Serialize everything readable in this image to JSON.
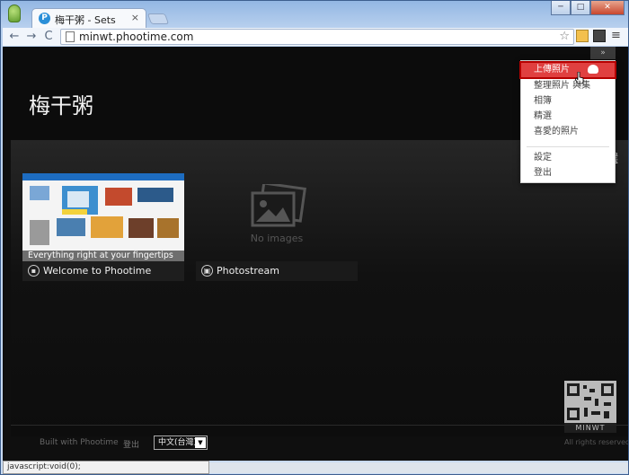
{
  "browser": {
    "tab_title": "梅干粥 - Sets",
    "tab_favicon": "P",
    "tab_close": "×",
    "url": "minwt.phootime.com",
    "status_text": "javascript:void(0);",
    "window_minimize": "─",
    "window_maximize": "□",
    "window_close": "✕"
  },
  "toolbar": {
    "back_icon": "←",
    "forward_icon": "→",
    "reload_icon": "C",
    "star_icon": "☆",
    "menu_icon": "≡"
  },
  "site": {
    "title": "梅干粥",
    "collapse_icon": "»",
    "featured_partial": "選"
  },
  "cards": [
    {
      "caption": "Everything right at your fingertips",
      "label": "Welcome to Phootime",
      "icon": "lock-icon"
    },
    {
      "label": "Photostream",
      "empty_text": "No images",
      "icon": "photo-icon"
    }
  ],
  "dropdown": {
    "items": [
      {
        "label": "上傳照片",
        "icon": "cloud-upload-icon",
        "highlight": true
      },
      {
        "label": "整理照片 與集"
      },
      {
        "label": "相簿"
      },
      {
        "label": "精選"
      },
      {
        "label": "喜愛的照片"
      },
      {
        "label": "設定"
      },
      {
        "label": "登出"
      }
    ]
  },
  "footer": {
    "built_with": "Built with Phootime",
    "logout": "登出",
    "language": "中文(台灣)",
    "rights": "All rights reserved",
    "qr_label": "MINWT"
  },
  "colors": {
    "highlight": "#e04040",
    "page_bg": "#0f0f0f",
    "brand": "#2b8fd8"
  }
}
